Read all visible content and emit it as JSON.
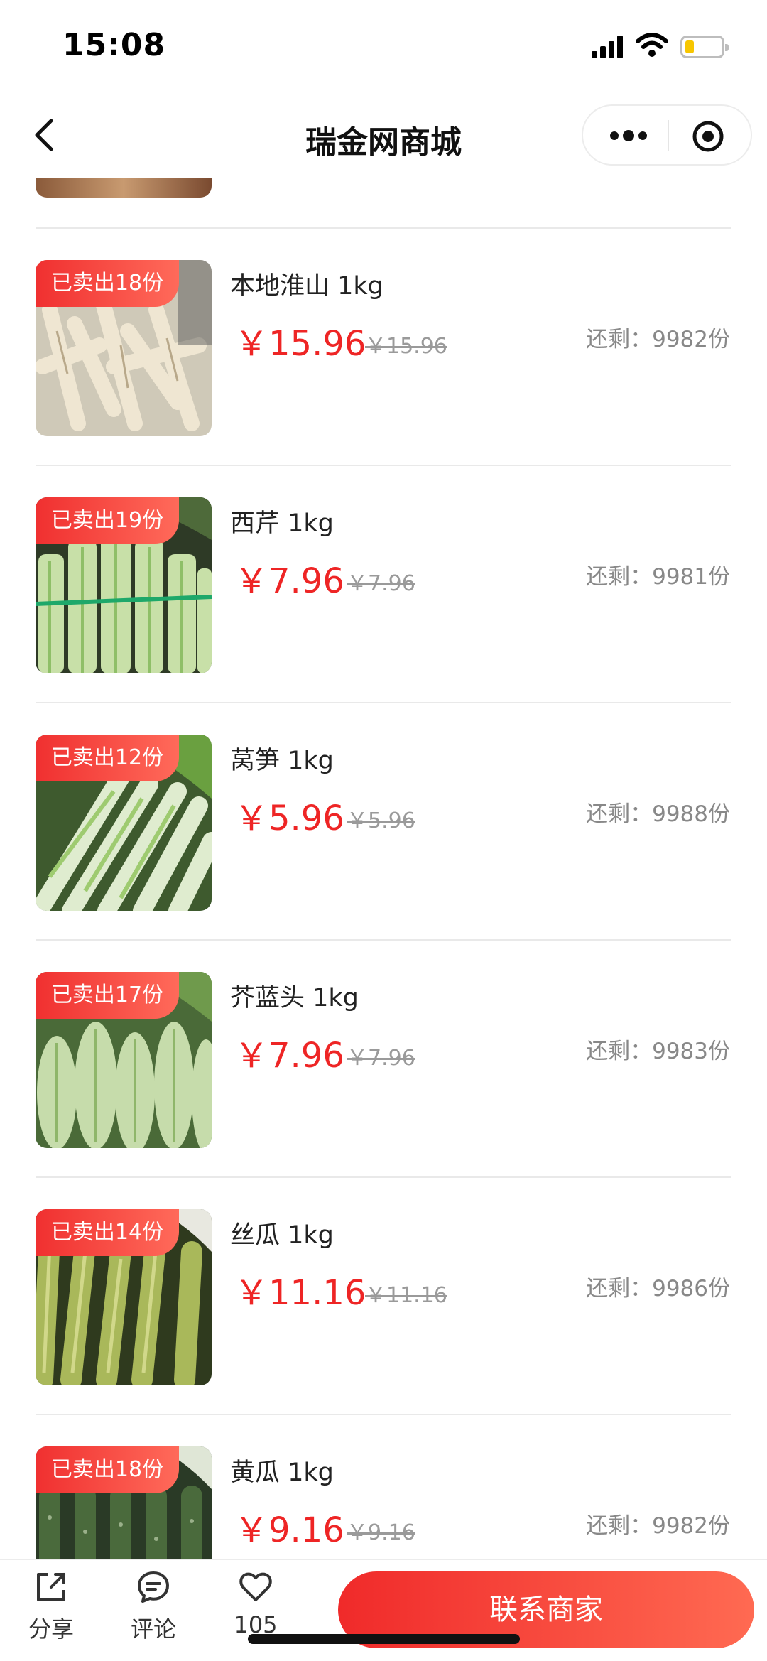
{
  "status": {
    "time": "15:08"
  },
  "nav": {
    "title": "瑞金网商城"
  },
  "colors": {
    "accent": "#ee2525",
    "badge_start": "#f03030",
    "badge_end": "#ff6a5a"
  },
  "products": [
    {
      "sold": "已卖出18份",
      "name": "本地淮山 1kg",
      "price": "￥15.96",
      "old_price": "￥15.96",
      "remaining": "还剩：9982份",
      "image": "yam"
    },
    {
      "sold": "已卖出19份",
      "name": "西芹 1kg",
      "price": "￥7.96",
      "old_price": "￥7.96",
      "remaining": "还剩：9981份",
      "image": "celery"
    },
    {
      "sold": "已卖出12份",
      "name": "莴笋 1kg",
      "price": "￥5.96",
      "old_price": "￥5.96",
      "remaining": "还剩：9988份",
      "image": "lettuce-stem"
    },
    {
      "sold": "已卖出17份",
      "name": "芥蓝头 1kg",
      "price": "￥7.96",
      "old_price": "￥7.96",
      "remaining": "还剩：9983份",
      "image": "kohlrabi"
    },
    {
      "sold": "已卖出14份",
      "name": "丝瓜 1kg",
      "price": "￥11.16",
      "old_price": "￥11.16",
      "remaining": "还剩：9986份",
      "image": "luffa"
    },
    {
      "sold": "已卖出18份",
      "name": "黄瓜 1kg",
      "price": "￥9.16",
      "old_price": "￥9.16",
      "remaining": "还剩：9982份",
      "image": "cucumber"
    }
  ],
  "bottom": {
    "share": "分享",
    "comment": "评论",
    "likes": "105",
    "contact": "联系商家"
  }
}
